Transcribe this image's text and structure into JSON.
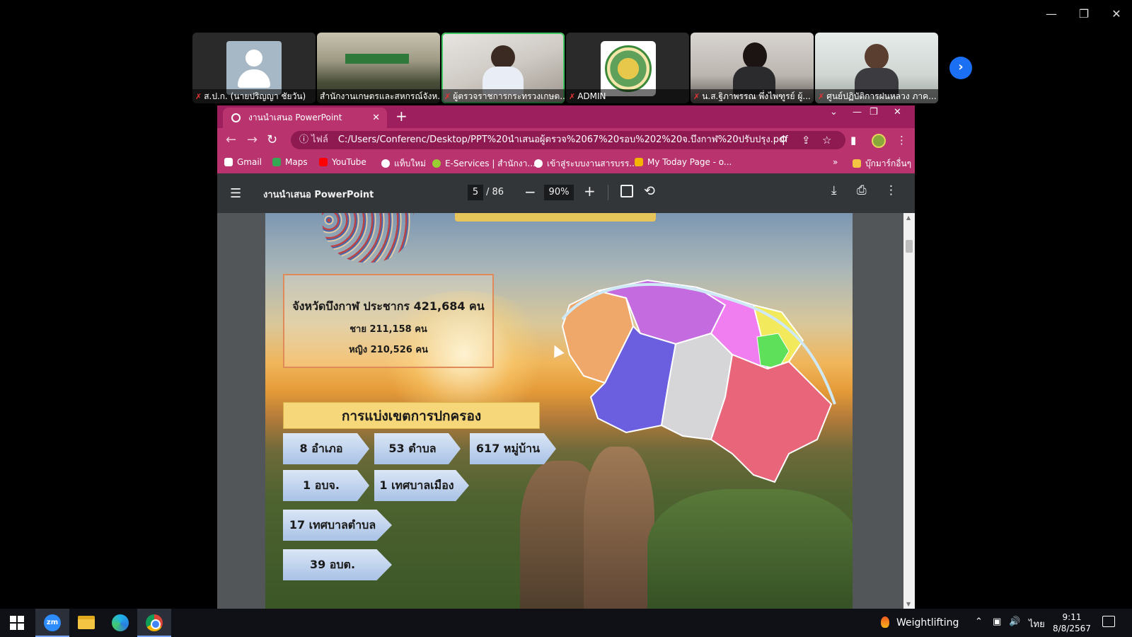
{
  "window_controls": {
    "minimize": "—",
    "restore": "❐",
    "close": "✕"
  },
  "participants": [
    {
      "name": "ส.ป.ก. (นายปริญญา ชัยวัน)",
      "type": "avatar"
    },
    {
      "name": "สำนักงานเกษตรและสหกรณ์จังห...",
      "type": "video"
    },
    {
      "name": "ผู้ตรวจราชการกระทรวงเกษต...",
      "type": "video",
      "active": true
    },
    {
      "name": "ADMIN",
      "type": "seal"
    },
    {
      "name": "น.ส.ฐิภาพรรณ พึ่งไพฑูรย์ ผู้...",
      "type": "video"
    },
    {
      "name": "ศูนย์ปฏิบัติการฝนหลวง ภาค...",
      "type": "video"
    }
  ],
  "browser": {
    "tab_title": "งานนำเสนอ PowerPoint",
    "new_tab": "+",
    "address_scheme": "ไฟล์",
    "address": "C:/Users/Conferenc/Desktop/PPT%20นำเสนอผู้ตรวจ%2067%20รอบ%202%20จ.บึงกาฬ%20ปรับปรุง.pdf",
    "bookmarks": [
      {
        "label": "Gmail",
        "color": "#ffffff"
      },
      {
        "label": "Maps",
        "color": "#34a853"
      },
      {
        "label": "YouTube",
        "color": "#ff0000"
      },
      {
        "label": "แท็บใหม่",
        "color": "#ffffff"
      },
      {
        "label": "E-Services | สำนักงา...",
        "color": "#9acd32"
      },
      {
        "label": "เข้าสู่ระบบงานสารบรร...",
        "color": "#ffffff"
      },
      {
        "label": "My Today Page - o...",
        "color": "#f5b400"
      }
    ],
    "bookmarks_overflow": "»",
    "other_bookmarks": "บุ๊กมาร์กอื่นๆ"
  },
  "pdf": {
    "title": "งานนำเสนอ PowerPoint",
    "page_current": "5",
    "page_total": "/ 86",
    "zoom": "90%"
  },
  "slide": {
    "population_main": "จังหวัดบึงกาฬ ประชากร 421,684 คน",
    "population_male": "ชาย 211,158 คน",
    "population_female": "หญิง 210,526 คน",
    "admin_heading": "การแบ่งเขตการปกครอง",
    "chips": {
      "amphoe": "8 อำเภอ",
      "tambon": "53 ตำบล",
      "muban": "617 หมู่บ้าน",
      "obj": "1 อบจ.",
      "city_muni": "1 เทศบาลเมือง",
      "tambon_muni": "17 เทศบาลตำบล",
      "obt": "39 อบต."
    }
  },
  "taskbar": {
    "weather": "Weightlifting",
    "language": "ไทย",
    "time": "9:11",
    "date": "8/8/2567"
  }
}
